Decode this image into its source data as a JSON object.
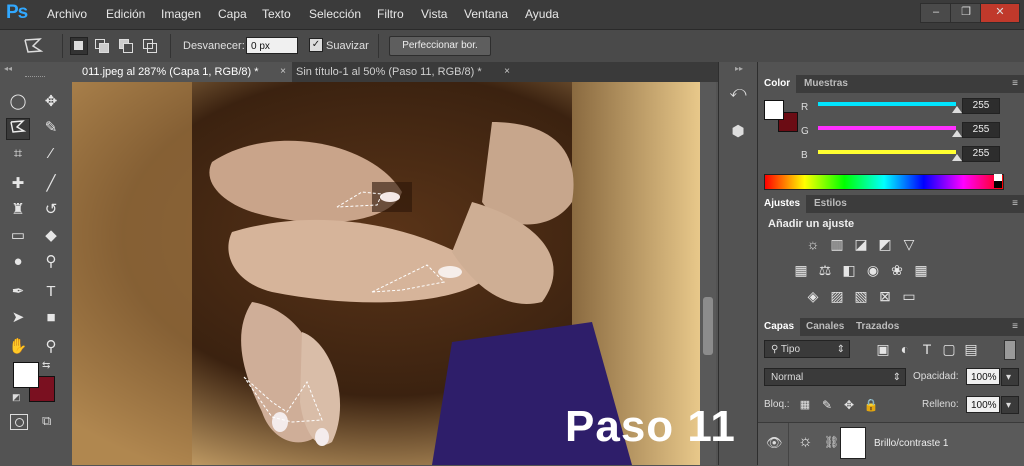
{
  "app": {
    "logo": "Ps"
  },
  "menu": [
    "Archivo",
    "Edición",
    "Imagen",
    "Capa",
    "Texto",
    "Selección",
    "Filtro",
    "Vista",
    "Ventana",
    "Ayuda"
  ],
  "window_controls": {
    "minimize": "–",
    "restore": "❐",
    "close": "✕"
  },
  "options_bar": {
    "feather_label": "Desvanecer:",
    "feather_value": "0 px",
    "smooth_label": "Suavizar",
    "refine_label": "Perfeccionar bor."
  },
  "doc_tabs": [
    {
      "label": "011.jpeg al 287% (Capa 1, RGB/8) *",
      "close": "×"
    },
    {
      "label": "Sin título-1 al 50% (Paso 11, RGB/8) *",
      "close": "×"
    }
  ],
  "colors": {
    "foreground": "#ffffff",
    "background": "#6b0c14",
    "swatch_fg": "#ffffff",
    "swatch_bg": "#7a1020"
  },
  "color_panel": {
    "tabs": [
      "Color",
      "Muestras"
    ],
    "channels": [
      {
        "label": "R",
        "value": "255",
        "color": "#00e5ff"
      },
      {
        "label": "G",
        "value": "255",
        "color": "#ff30ff"
      },
      {
        "label": "B",
        "value": "255",
        "color": "#ffff30"
      }
    ]
  },
  "adjust_panel": {
    "tabs": [
      "Ajustes",
      "Estilos"
    ],
    "heading": "Añadir un ajuste"
  },
  "layers_panel": {
    "tabs": [
      "Capas",
      "Canales",
      "Trazados"
    ],
    "filter": "Tipo",
    "blend_mode": "Normal",
    "opacity_label": "Opacidad:",
    "opacity_value": "100%",
    "lock_label": "Bloq.:",
    "fill_label": "Relleno:",
    "fill_value": "100%",
    "layer_name": "Brillo/contraste 1"
  },
  "overlay_text": "Paso 11"
}
